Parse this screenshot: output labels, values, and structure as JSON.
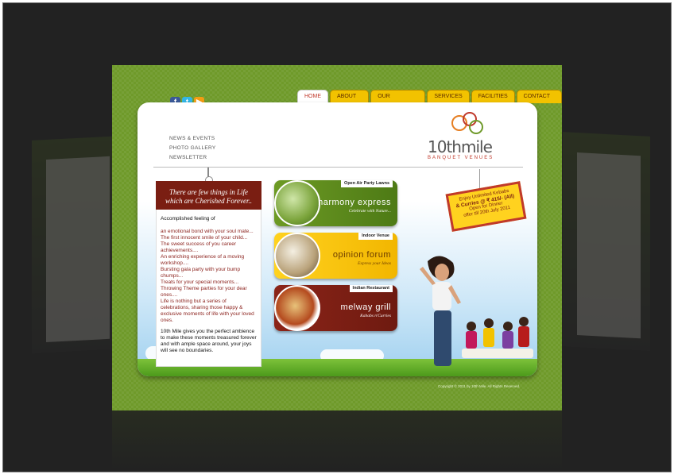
{
  "nav": {
    "tabs": [
      {
        "label": "HOME"
      },
      {
        "label": "ABOUT US"
      },
      {
        "label": "OUR OFFERINGS"
      },
      {
        "label": "SERVICES"
      },
      {
        "label": "FACILITIES"
      },
      {
        "label": "CONTACT US"
      }
    ],
    "active": "HOME"
  },
  "sublinks": [
    "NEWS & EVENTS",
    "PHOTO GALLERY",
    "NEWSLETTER"
  ],
  "logo": {
    "name": "10thmile",
    "tagline": "Banquet Venues"
  },
  "note": {
    "heading_line1": "There are few things in Life",
    "heading_line2": "which are Cherished Forever..",
    "lead": "Accomplished feeling of",
    "items": [
      "an emotional bond with your soul mate...",
      "The first innocent smile of your child...",
      "The sweet success of you career achievements....",
      "An enriching experience of a moving workshop....",
      "Bursting gala party with your bump chumps...",
      "Treats for your special moments...",
      "Throwing Theme parties for your dear ones....",
      "Life is nothing but a series of celebrations, sharing those happy & exclusive moments of life with your loved ones."
    ],
    "outro": "10th Mile gives you the perfect ambience to make these moments treasured forever and with ample space around, your joys will see no boundaries."
  },
  "venues": [
    {
      "category": "Open Air Party Lawns",
      "title": "harmony express",
      "subtitle": "Celebrate with Nature..."
    },
    {
      "category": "Indoor Venue",
      "title": "opinion forum",
      "subtitle": "Express your Ideas"
    },
    {
      "category": "Indian Restaurant",
      "title": "melway grill",
      "subtitle": "Kababs n'Curries"
    }
  ],
  "offer": {
    "line1": "Enjoy Unlimited Kebabs",
    "line2": "& Curries @ ₹ 415/- (All)",
    "line3": "Open for Dinner",
    "line4": "offer till 20th July 2011"
  },
  "copyright": "Copyright © 2011 by 10th Mile. All Rights Reserved.",
  "colors": {
    "brand_green": "#6f9a2a",
    "tab_yellow": "#f2c200",
    "maroon": "#7a1e12"
  }
}
